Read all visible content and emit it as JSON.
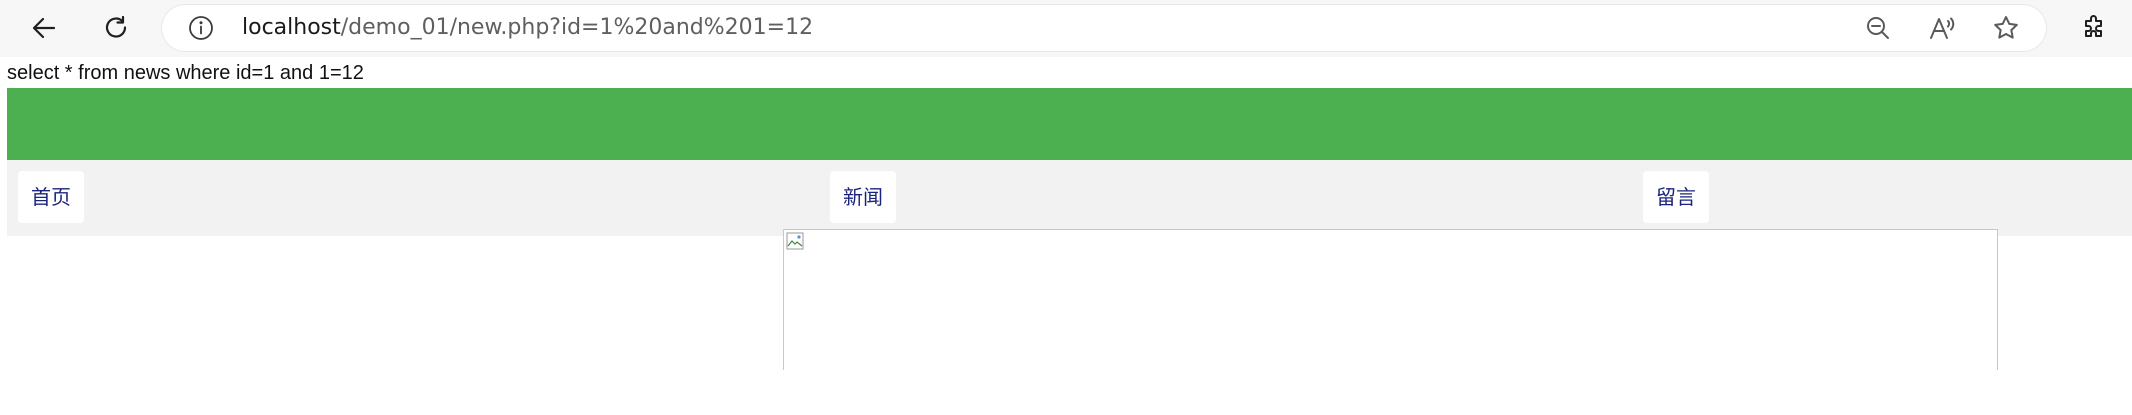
{
  "browser": {
    "url_host": "localhost",
    "url_path": "/demo_01/new.php?id=1%20and%201=12",
    "icons": {
      "back": "arrow-left-icon",
      "reload": "reload-icon",
      "info": "info-icon",
      "zoom": "zoom-out-icon",
      "read_aloud": "read-aloud-icon",
      "favorite": "star-icon",
      "extensions": "puzzle-icon"
    }
  },
  "page": {
    "query": "select * from news where id=1 and 1=12",
    "header_color": "#4caf50",
    "nav": {
      "home": "首页",
      "news": "新闻",
      "message": "留言"
    },
    "nav_text_color": "#1a237e"
  }
}
